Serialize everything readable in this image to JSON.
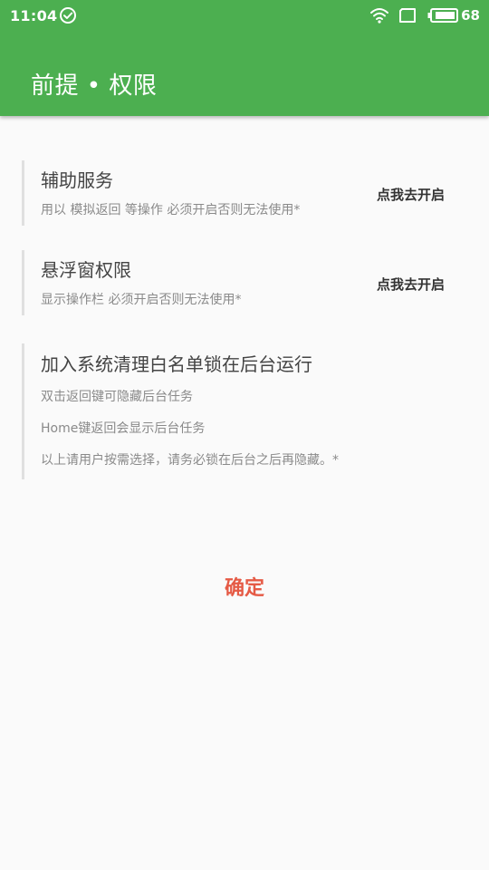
{
  "status_bar": {
    "time": "11:04",
    "battery": "68",
    "icons": [
      "check-circle-icon",
      "wifi-icon",
      "screen-icon",
      "battery-icon"
    ]
  },
  "app_bar": {
    "title": "前提 • 权限",
    "color": "#4CAF50"
  },
  "permissions": [
    {
      "title": "辅助服务",
      "description": "用以 模拟返回 等操作  必须开启否则无法使用*",
      "action": "点我去开启"
    },
    {
      "title": "悬浮窗权限",
      "description": "显示操作栏  必须开启否则无法使用*",
      "action": "点我去开启"
    },
    {
      "title": "加入系统清理白名单锁在后台运行",
      "lines": [
        "双击返回键可隐藏后台任务",
        "Home键返回会显示后台任务",
        "以上请用户按需选择，请务必锁在后台之后再隐藏。*"
      ]
    }
  ],
  "confirm": {
    "label": "确定",
    "color": "#E55A45"
  }
}
